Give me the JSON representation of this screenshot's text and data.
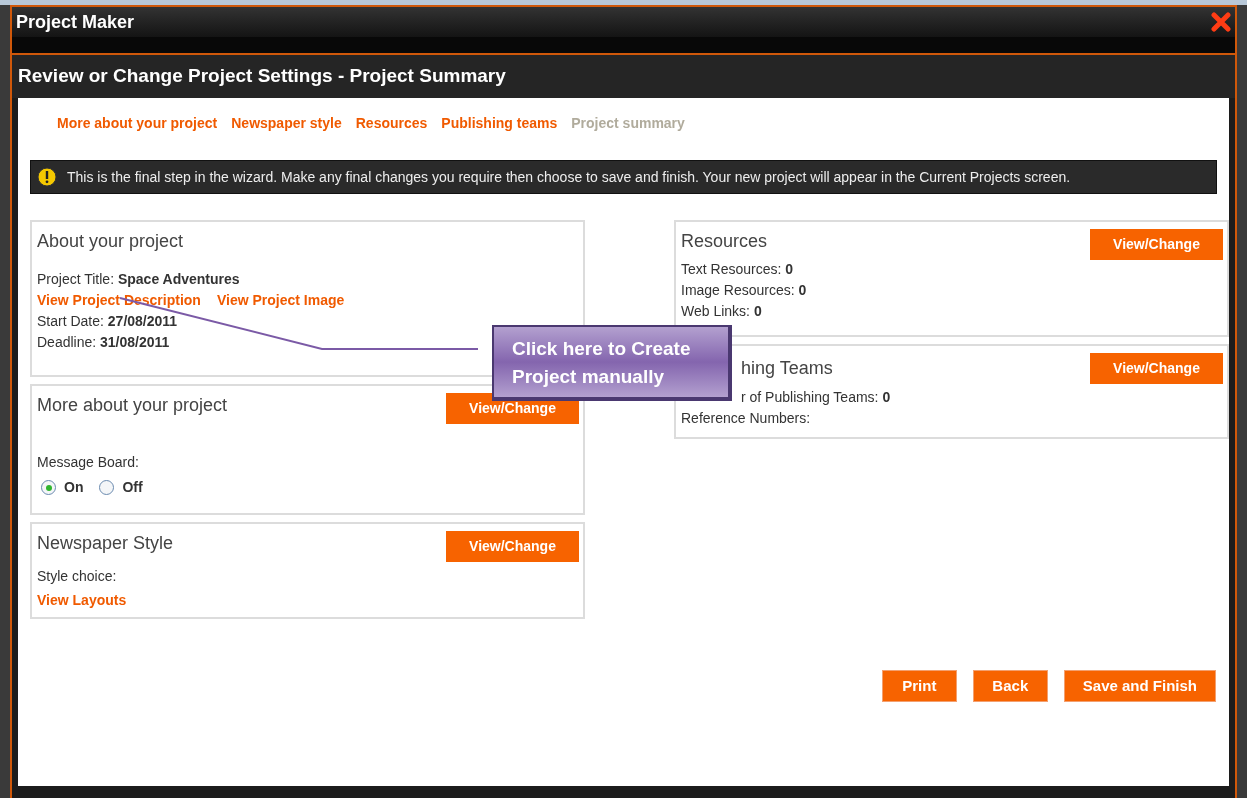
{
  "window": {
    "title": "Project Maker"
  },
  "page_title": "Review or Change Project Settings - Project Summary",
  "steps": [
    {
      "label": "More about your project",
      "selected": false
    },
    {
      "label": "Newspaper style",
      "selected": false
    },
    {
      "label": "Resources",
      "selected": false
    },
    {
      "label": "Publishing teams",
      "selected": false
    },
    {
      "label": "Project summary",
      "selected": true
    }
  ],
  "notice": "This is the final step in the wizard. Make any final changes you require then choose to save and finish. Your new project will appear in the Current Projects screen.",
  "about": {
    "heading": "About your project",
    "title_label": "Project Title:",
    "title_value": "Space Adventures",
    "links": [
      "View Project Description",
      "View Project Image"
    ],
    "start_label": "Start Date:",
    "start_value": "27/08/2011",
    "deadline_label": "Deadline:",
    "deadline_value": "31/08/2011"
  },
  "more": {
    "heading": "More about your project",
    "button": "View/Change",
    "board_label": "Message Board:",
    "options": [
      {
        "label": "On",
        "selected": true
      },
      {
        "label": "Off",
        "selected": false
      }
    ]
  },
  "newspaper": {
    "heading": "Newspaper Style",
    "button": "View/Change",
    "style_label": "Style choice:",
    "link": "View Layouts"
  },
  "resources": {
    "heading": "Resources",
    "button": "View/Change",
    "rows": [
      {
        "label": "Text Resources:",
        "value": "0"
      },
      {
        "label": "Image Resources:",
        "value": "0"
      },
      {
        "label": "Web Links:",
        "value": "0"
      }
    ]
  },
  "teams": {
    "heading": "hing Teams",
    "button": "View/Change",
    "count_label": "r of Publishing Teams:",
    "count_value": "0",
    "reference_label": "Reference Numbers:"
  },
  "callout": "Click here to Create Project manually",
  "buttons": [
    "Print",
    "Back",
    "Save and Finish"
  ]
}
